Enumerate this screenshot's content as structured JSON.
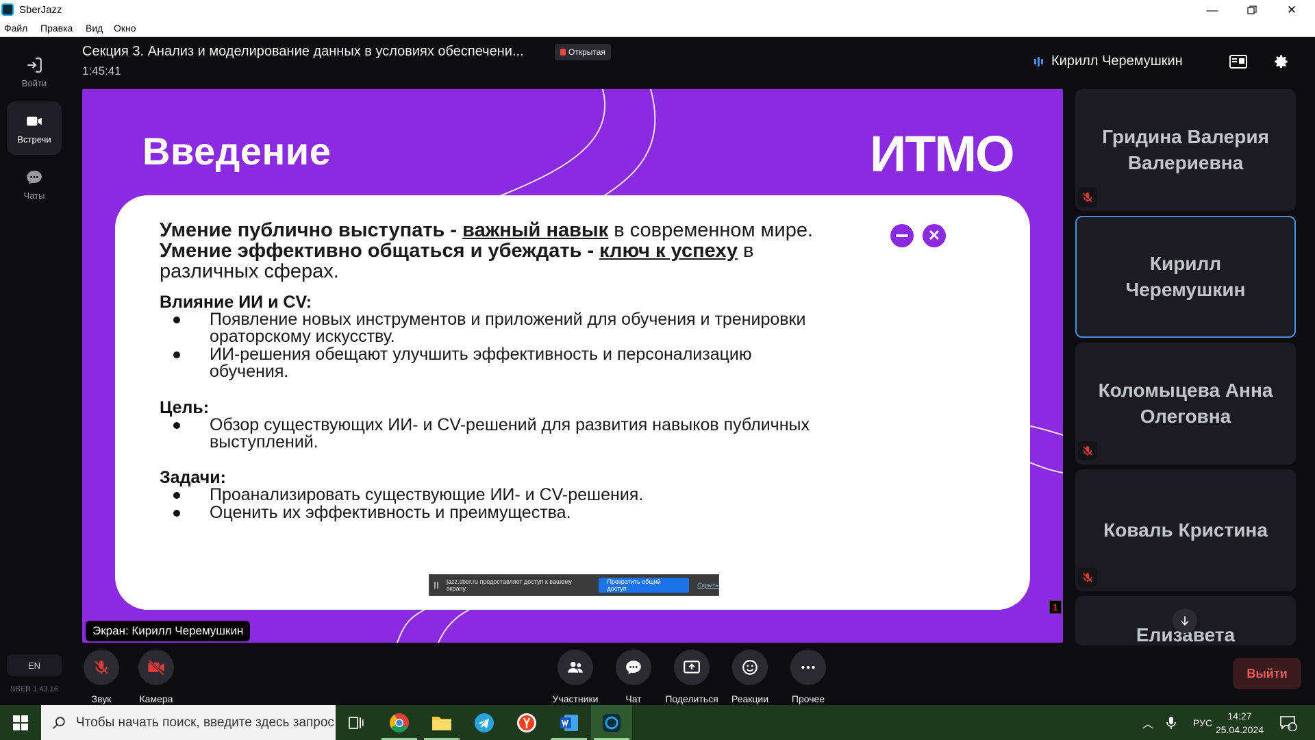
{
  "window": {
    "title": "SberJazz"
  },
  "menu": [
    "Файл",
    "Правка",
    "Вид",
    "Окно"
  ],
  "rail": {
    "items": [
      {
        "label": "Войти",
        "icon": "login-icon"
      },
      {
        "label": "Встречи",
        "icon": "camera-icon",
        "active": true
      },
      {
        "label": "Чаты",
        "icon": "chat-icon"
      }
    ],
    "lang": "EN",
    "version": "SBER 1.43.16"
  },
  "header": {
    "title": "Секция 3. Анализ и моделирование данных в условиях обеспечени...",
    "badge": "Открытая",
    "timer": "1:45:41",
    "active_speaker": "Кирилл Черемушкин"
  },
  "slide": {
    "title": "Введение",
    "logo": "ИТМО",
    "line1_a": "Умение публично выступать - ",
    "line1_b": "важный навык",
    "line1_c": " в современном мире.",
    "line2_a": "Умение эффективно общаться и убеждать - ",
    "line2_b": "ключ к успеху",
    "line2_c": " в",
    "line3": "различных сферах.",
    "section1": "Влияние ИИ и CV:",
    "b1_1": "Появление новых инструментов и приложений для обучения и тренировки",
    "b1_1b": "ораторскому искусству.",
    "b1_2": "ИИ-решения обещают улучшить эффективность и персонализацию",
    "b1_2b": "обучения.",
    "section2": "Цель:",
    "b2_1": "Обзор существующих ИИ- и CV-решений для развития навыков публичных",
    "b2_1b": "выступлений.",
    "section3": "Задачи:",
    "b3_1": "Проанализировать существующие ИИ- и CV-решения.",
    "b3_2": "Оценить их эффективность и преимущества.",
    "page": "1"
  },
  "share_bar": {
    "message": "jazz.sber.ru предоставляет доступ к вашему экрану.",
    "stop": "Прекратить общий доступ",
    "hide": "Скрыть"
  },
  "screen_label": "Экран: Кирилл Черемушкин",
  "participants": [
    {
      "name": "Гридина Валерия Валериевна",
      "muted": true
    },
    {
      "name": "Кирилл Черемушкин",
      "muted": false,
      "active": true
    },
    {
      "name": "Коломыцева Анна Олеговна",
      "muted": true
    },
    {
      "name": "Коваль Кристина",
      "muted": true
    },
    {
      "name": "Елизавета",
      "muted": false
    }
  ],
  "controls": {
    "sound": "Звук",
    "camera": "Камера",
    "participants": "Участники",
    "chat": "Чат",
    "share": "Поделиться",
    "reactions": "Реакции",
    "more": "Прочее",
    "leave": "Выйти"
  },
  "taskbar": {
    "search_placeholder": "Чтобы начать поиск, введите здесь запрос",
    "lang": "РУС",
    "time": "14:27",
    "date": "25.04.2024",
    "notifications": "1"
  },
  "colors": {
    "slide_purple": "#8a2be2",
    "accent_blue": "#4a90e2",
    "leave_red": "#ff5b5b"
  }
}
